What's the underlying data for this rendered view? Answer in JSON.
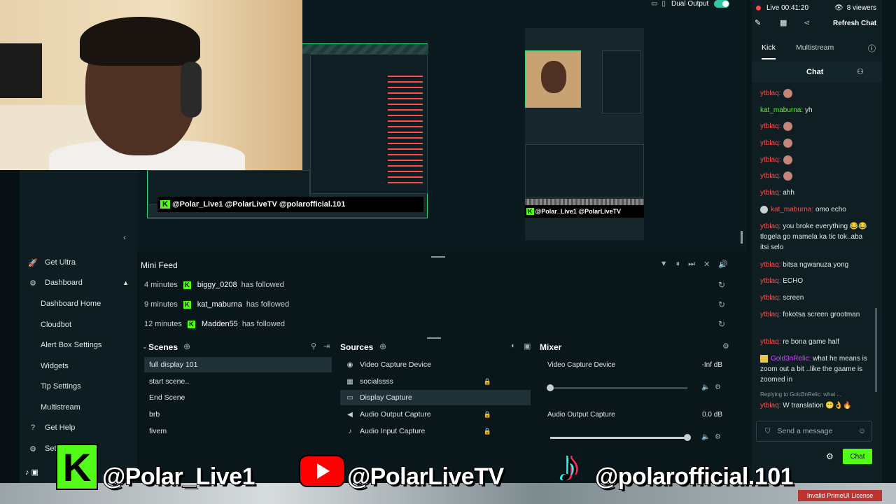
{
  "top_bar": {
    "dual_output_label": "Dual Output"
  },
  "sidebar": {
    "items": [
      {
        "icon": "rocket-icon",
        "label": "Get Ultra"
      },
      {
        "icon": "dashboard-icon",
        "label": "Dashboard"
      },
      {
        "label": "Dashboard Home"
      },
      {
        "label": "Cloudbot"
      },
      {
        "label": "Alert Box Settings"
      },
      {
        "label": "Widgets"
      },
      {
        "label": "Tip Settings"
      },
      {
        "label": "Multistream"
      },
      {
        "icon": "help-icon",
        "label": "Get Help"
      },
      {
        "icon": "gear-icon",
        "label": "Setti"
      }
    ]
  },
  "preview": {
    "left_overlay_text": "@Polar_Live1  @PolarLiveTV  @polarofficial.101",
    "right_overlay_text": "@Polar_Live1  @PolarLiveTV"
  },
  "mini_feed": {
    "title": "Mini Feed",
    "events": [
      {
        "time": "4 minutes",
        "name": "biggy_0208",
        "action": "has followed"
      },
      {
        "time": "9 minutes",
        "name": "kat_maburna",
        "action": "has followed"
      },
      {
        "time": "12 minutes",
        "name": "Madden55",
        "action": "has followed"
      }
    ]
  },
  "scenes": {
    "title": "Scenes",
    "items": [
      "full display 101",
      "start scene..",
      "End Scene",
      "brb",
      "fivem"
    ],
    "selected": "full display 101"
  },
  "sources": {
    "title": "Sources",
    "items": [
      {
        "icon": "camera-icon",
        "label": "Video Capture Device"
      },
      {
        "icon": "image-icon",
        "label": "socialssss"
      },
      {
        "icon": "monitor-icon",
        "label": "Display Capture"
      },
      {
        "icon": "speaker-icon",
        "label": "Audio Output Capture"
      },
      {
        "icon": "mic-icon",
        "label": "Audio Input Capture"
      }
    ],
    "selected": "Display Capture"
  },
  "mixer": {
    "title": "Mixer",
    "channels": [
      {
        "label": "Video Capture Device",
        "level": "-Inf dB",
        "volume": 0.0
      },
      {
        "label": "Audio Output Capture",
        "level": "0.0 dB",
        "volume": 1.0
      }
    ]
  },
  "chat": {
    "status": "Live 00:41:20",
    "viewers": "8 viewers",
    "refresh_label": "Refresh Chat",
    "tabs": [
      "Kick",
      "Multistream"
    ],
    "header": "Chat",
    "messages": [
      {
        "user": "ytblaq",
        "text": ""
      },
      {
        "user": "kat_maburna",
        "text": "yh"
      },
      {
        "user": "ytblaq",
        "text": ""
      },
      {
        "user": "ytblaq",
        "text": ""
      },
      {
        "user": "ytblaq",
        "text": ""
      },
      {
        "user": "ytblaq",
        "text": ""
      },
      {
        "user": "ytblaq",
        "text": "ahh"
      },
      {
        "user": "kat_maburna",
        "text": "omo echo"
      },
      {
        "user": "ytblaq",
        "text": "you broke everything 😂😂tlogela go mamela ka tic tok..aba itsi selo"
      },
      {
        "user": "ytblaq",
        "text": "bitsa ngwanuza yong"
      },
      {
        "user": "ytblaq",
        "text": "ECHO"
      },
      {
        "user": "ytblaq",
        "text": "screen"
      },
      {
        "user": "ytblaq",
        "text": "fokotsa screen grootman"
      },
      {
        "user": "ytblaq",
        "text": "re bona game half"
      },
      {
        "user": "Gold3nRelic",
        "text": "what he means is zoom out a bit ..like the gaame is zoomed in"
      },
      {
        "user": "",
        "text": "Replying to Gold3nRelic: what ..."
      },
      {
        "user": "ytblaq",
        "text": "W translation 😁👌🔥"
      }
    ],
    "input_placeholder": "Send a message",
    "send_label": "Chat"
  },
  "overlay": {
    "kick_handle": "@Polar_Live1",
    "youtube_handle": "@PolarLiveTV",
    "tiktok_handle": "@polarofficial.101",
    "corner_text": "Invalid PrimeUI License"
  },
  "colors": {
    "kick_green": "#53fc18",
    "youtube_red": "#ff0000",
    "accent_green": "#31c3a2",
    "chat_red_user": "#ff4d4d"
  }
}
